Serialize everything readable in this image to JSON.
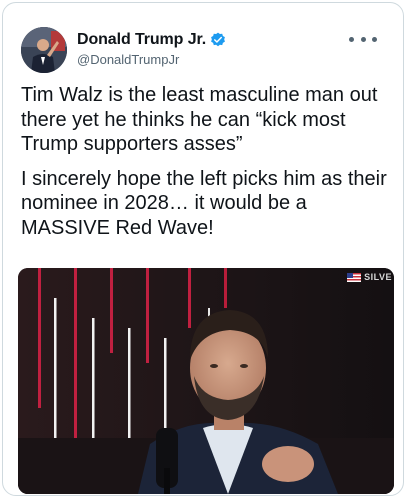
{
  "tweet": {
    "display_name": "Donald Trump Jr.",
    "handle": "@DonaldTrumpJr",
    "paragraphs": [
      "Tim Walz is the least masculine man out there yet he thinks he can “kick most Trump supporters asses”",
      "I sincerely hope the left picks him as their nominee in 2028… it would be a MASSIVE Red Wave!"
    ],
    "verified": true
  },
  "media": {
    "watermark": "SILVE"
  },
  "colors": {
    "name": "#0f1419",
    "handle": "#536471",
    "verified_badge": "#1d9bf0",
    "border": "#cfd9de"
  },
  "icons": {
    "verified": "verified-badge-icon",
    "more": "more-options-icon"
  }
}
